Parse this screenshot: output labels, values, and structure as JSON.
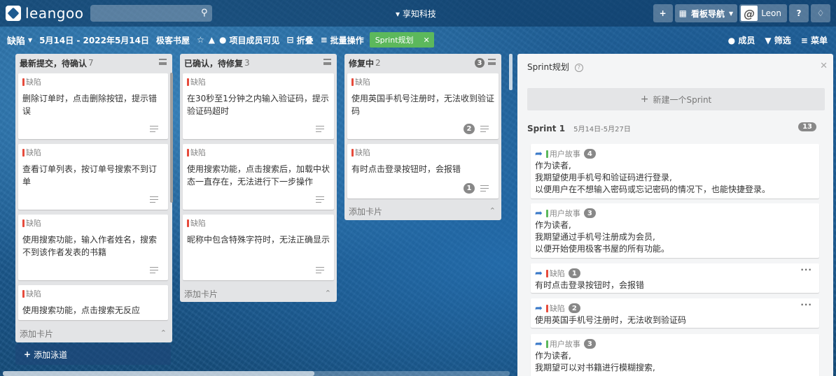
{
  "app": {
    "logo_text": "leangoo",
    "search_placeholder": "",
    "org_name": "▾ 享知科技",
    "board_nav": "看板导航",
    "user_name": "Leon"
  },
  "board": {
    "name": "缺陷",
    "date_range": "5月14日 - 2022年5月14日",
    "project": "极客书屋",
    "members_visible": "项目成员可见",
    "fold": "折叠",
    "batch": "批量操作",
    "sprint_tag": "Sprint规划",
    "members": "成员",
    "filter": "筛选",
    "menu": "菜单"
  },
  "lists": [
    {
      "title": "最新提交，待确认",
      "count": "7",
      "cards": [
        {
          "tag": "缺陷",
          "title": "删除订单时，点击删除按钮，提示错误"
        },
        {
          "tag": "缺陷",
          "title": "查看订单列表，按订单号搜索不到订单"
        },
        {
          "tag": "缺陷",
          "title": "使用搜索功能，输入作者姓名，搜索不到该作者发表的书籍"
        },
        {
          "tag": "缺陷",
          "title": "使用搜索功能，点击搜索无反应"
        }
      ],
      "add_card": "添加卡片"
    },
    {
      "title": "已确认，待修复",
      "count": "3",
      "cards": [
        {
          "tag": "缺陷",
          "title": "在30秒至1分钟之内输入验证码，提示验证码超时"
        },
        {
          "tag": "缺陷",
          "title": "使用搜索功能，点击搜索后，加载中状态一直存在，无法进行下一步操作"
        },
        {
          "tag": "缺陷",
          "title": "昵称中包含特殊字符时，无法正确显示"
        }
      ],
      "add_card": "添加卡片"
    },
    {
      "title": "修复中",
      "count": "2",
      "badge": "3",
      "cards": [
        {
          "tag": "缺陷",
          "title": "使用英国手机号注册时，无法收到验证码",
          "badge": "2"
        },
        {
          "tag": "缺陷",
          "title": "有时点击登录按钮时，会报错",
          "badge": "1"
        }
      ],
      "add_card": "添加卡片"
    }
  ],
  "add_lane": "添加泳道",
  "sprint_panel": {
    "title": "Sprint规划",
    "new_sprint": "新建一个Sprint",
    "sprint_name": "Sprint 1",
    "sprint_dates": "5月14日-5月27日",
    "sprint_count": "13",
    "cards": [
      {
        "tag": "用户故事",
        "num": "4",
        "lines": [
          "作为读者,",
          "我期望使用手机号和验证码进行登录,",
          "以便用户在不想输入密码或忘记密码的情况下，也能快捷登录。"
        ]
      },
      {
        "tag": "用户故事",
        "num": "3",
        "lines": [
          "作为读者,",
          "我期望通过手机号注册成为会员,",
          "以便开始使用极客书屋的所有功能。"
        ]
      },
      {
        "tag": "缺陷",
        "num": "1",
        "lines": [
          "有时点击登录按钮时，会报错"
        ]
      },
      {
        "tag": "缺陷",
        "num": "2",
        "lines": [
          "使用英国手机号注册时，无法收到验证码"
        ]
      },
      {
        "tag": "用户故事",
        "num": "3",
        "lines": [
          "作为读者,",
          "我期望可以对书籍进行模糊搜索,"
        ]
      }
    ]
  },
  "colors": {
    "defect": "#e64b3c",
    "story": "#5cb85c",
    "sprint_tag": "#5cb85c"
  },
  "icons": [
    "search-icon",
    "plus-icon",
    "grid-icon",
    "help-icon",
    "bell-icon",
    "star-icon",
    "chart-icon",
    "people-icon",
    "fold-icon",
    "list-icon",
    "close-icon",
    "menu-icon",
    "share-icon",
    "lines-icon",
    "collapse-icon"
  ]
}
